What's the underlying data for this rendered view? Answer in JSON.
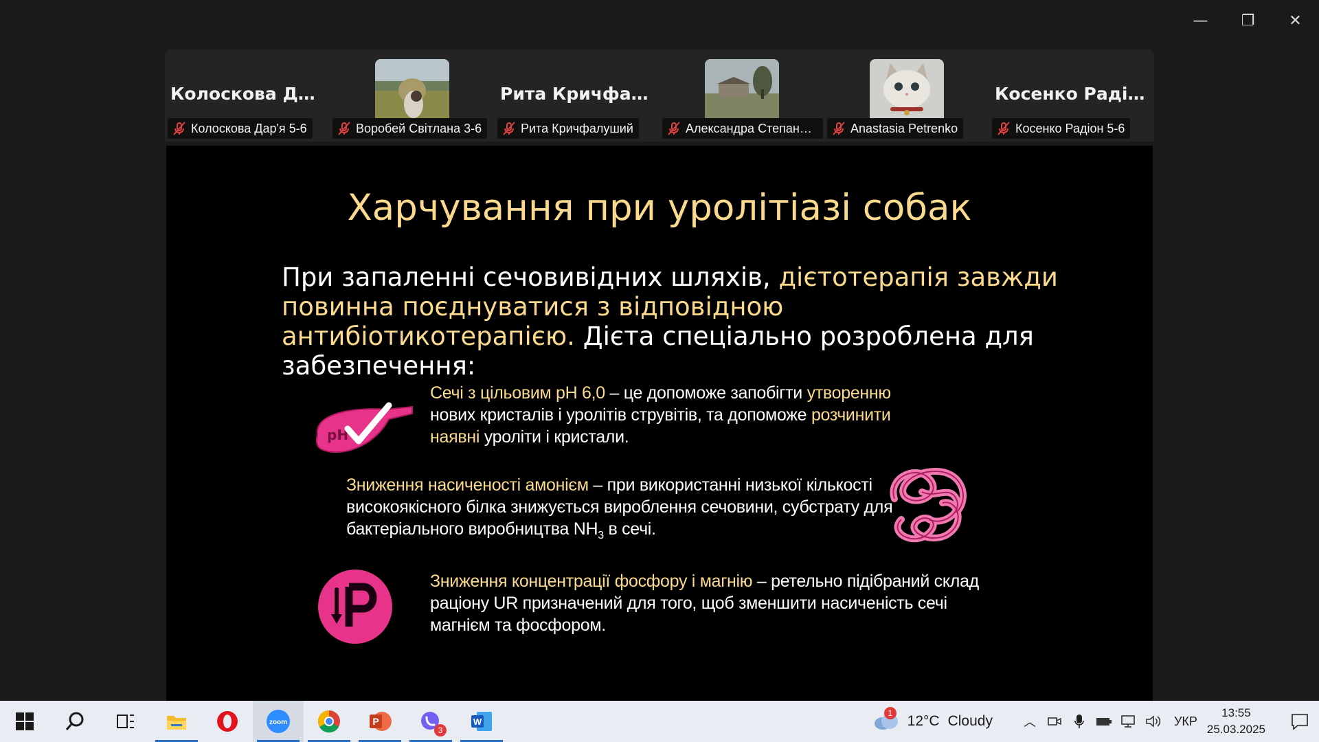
{
  "window_controls": {
    "minimize": "—",
    "restore": "❐",
    "close": "✕"
  },
  "participants": [
    {
      "display_name": "Колоскова  Дар...",
      "label": "Колоскова Дар'я 5-6",
      "video": false
    },
    {
      "display_name": "",
      "label": "Воробей Світлана 3-6",
      "video": true,
      "photo": "field-portrait"
    },
    {
      "display_name": "Рита  Кричфалу...",
      "label": "Рита Кричфалуший",
      "video": false
    },
    {
      "display_name": "",
      "label": "Александра Степанен...",
      "video": true,
      "photo": "landscape-house"
    },
    {
      "display_name": "",
      "label": "Anastasia Petrenko",
      "video": true,
      "photo": "cat"
    },
    {
      "display_name": "Косенко  Радіо...",
      "label": "Косенко Радіон 5-6",
      "video": false
    }
  ],
  "slide": {
    "title": "Харчування при уролітіазі собак",
    "intro_plain1": "При запаленні сечовивідних шляхів, ",
    "intro_hl": "дієтотерапія завжди повинна поєднуватися з відповідною антибіотикотерапією.",
    "intro_plain2": " Дієта спеціально розроблена для забезпечення:",
    "bullets": [
      {
        "icon": "ph-check-icon",
        "hl1": "Сечі з цільовим рН 6,0",
        "t1": " – це допоможе запобігти ",
        "hl2": "утворенню",
        "t2": " нових кристалів і уролітів струвітів, та допоможе ",
        "hl3": "розчинити наявні",
        "t3": " уроліти і кристали."
      },
      {
        "icon": "protein-molecule-icon",
        "hl1": "Зниження насиченості амонієм",
        "t1": " – при використанні низької кількості високоякісного білка знижується вироблення сечовини, субстрату для бактеріального виробництва NH",
        "sub": "3",
        "t2": " в сечі."
      },
      {
        "icon": "phosphorus-down-icon",
        "hl1": "Зниження концентрації фосфору і магнію",
        "t1": " – ретельно підібраний склад раціону UR призначений для того, щоб зменшити насиченість сечі магнієм та фосфором."
      }
    ],
    "colors": {
      "highlight": "#fbd98d",
      "accent_pink": "#e8338a"
    }
  },
  "taskbar": {
    "apps": [
      {
        "name": "start",
        "icon": "windows-icon"
      },
      {
        "name": "search",
        "icon": "search-icon"
      },
      {
        "name": "task-view",
        "icon": "task-view-icon"
      },
      {
        "name": "file-explorer",
        "icon": "folder-icon"
      },
      {
        "name": "opera",
        "icon": "opera-icon"
      },
      {
        "name": "zoom",
        "icon": "zoom-icon",
        "label": "zoom"
      },
      {
        "name": "chrome",
        "icon": "chrome-icon"
      },
      {
        "name": "powerpoint",
        "icon": "powerpoint-icon",
        "label": "P"
      },
      {
        "name": "viber",
        "icon": "viber-icon",
        "badge": "3"
      },
      {
        "name": "word",
        "icon": "word-icon",
        "label": "W"
      }
    ],
    "weather": {
      "temp": "12°C",
      "condition": "Cloudy",
      "badge": "1"
    },
    "language": "УКР",
    "time": "13:55",
    "date": "25.03.2025"
  }
}
